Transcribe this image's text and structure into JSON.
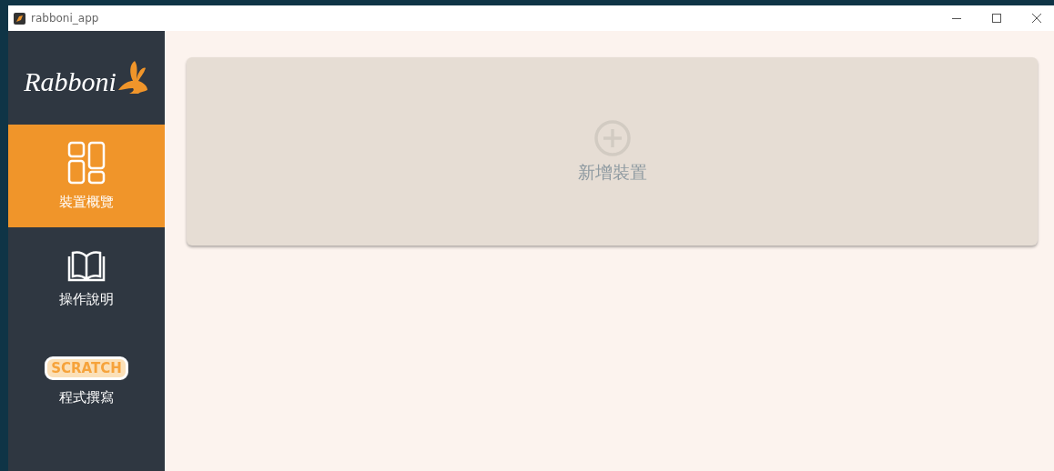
{
  "window": {
    "title": "rabboni_app"
  },
  "sidebar": {
    "logo": {
      "text": "Rabboni"
    },
    "items": [
      {
        "kind": "grid",
        "label": "裝置概覽",
        "selected": true
      },
      {
        "kind": "book",
        "label": "操作說明",
        "selected": false
      },
      {
        "kind": "scratch",
        "badge": "SCRATCH",
        "label": "程式撰寫",
        "selected": false
      }
    ]
  },
  "main": {
    "add_device": {
      "label": "新增裝置"
    }
  }
}
